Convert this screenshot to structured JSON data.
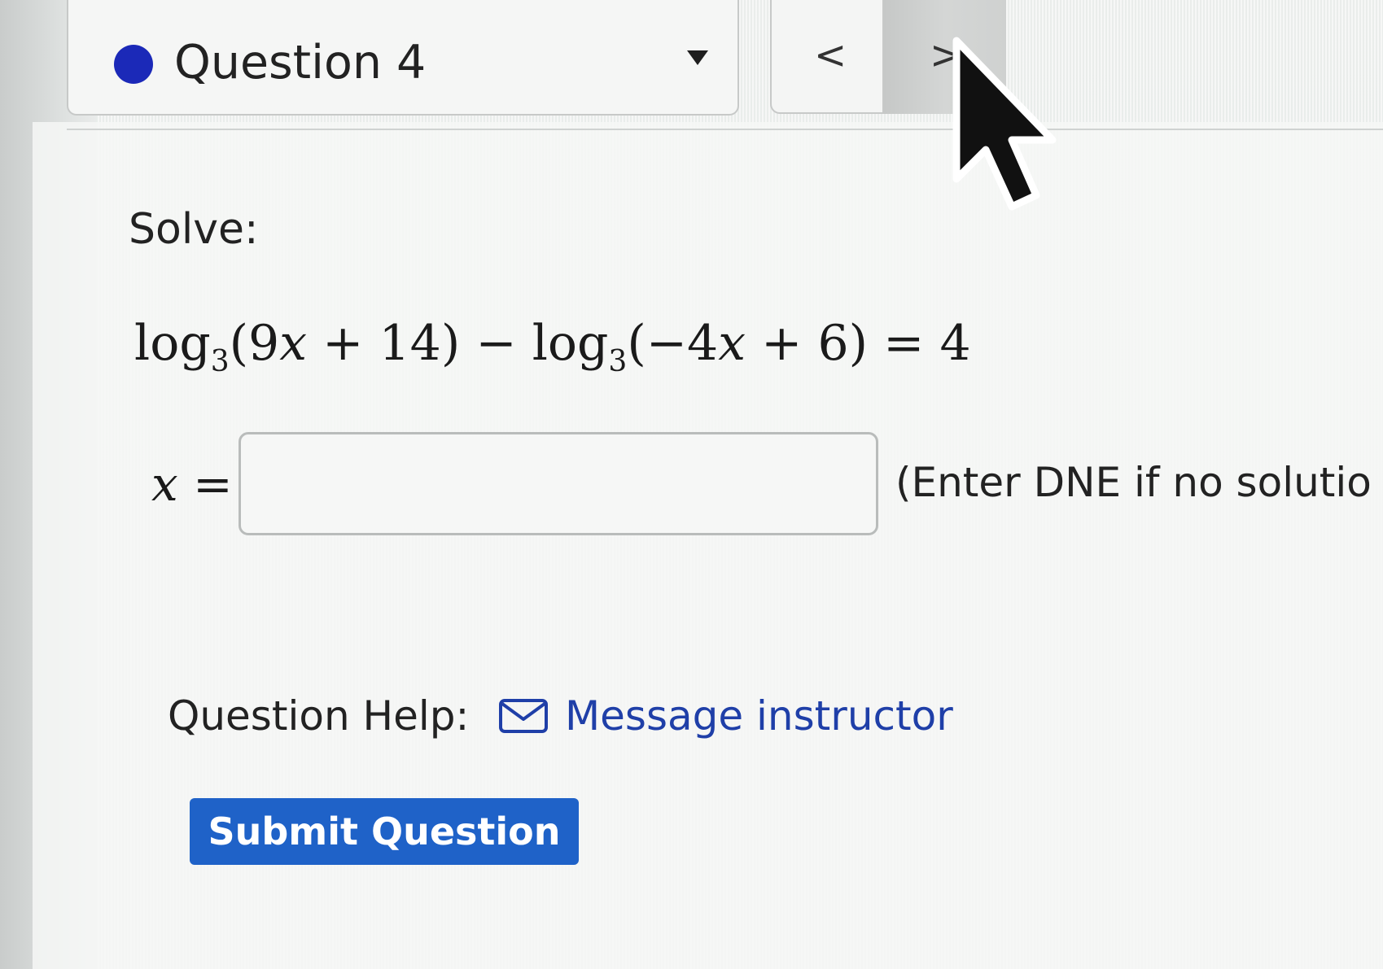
{
  "header": {
    "question_select": {
      "status_color": "#1b29b8",
      "label": "Question 4",
      "caret_icon": "caret-down-icon"
    },
    "nav": {
      "prev_glyph": "<",
      "next_glyph": ">"
    }
  },
  "problem": {
    "instruction": "Solve:",
    "equation": {
      "log_text": "log",
      "base": "3",
      "arg1": "(9x + 14)",
      "minus": " − ",
      "arg2": "(−4x + 6)",
      "rhs": " = 4"
    },
    "answer": {
      "variable": "x",
      "equals": " =",
      "value": "",
      "hint": "(Enter DNE if no solutio"
    }
  },
  "help": {
    "label": "Question Help:",
    "link_icon": "mail-icon",
    "link_text": "Message instructor",
    "link_color": "#1f3fa8"
  },
  "actions": {
    "submit_label": "Submit Question",
    "submit_color": "#1f62c8"
  }
}
